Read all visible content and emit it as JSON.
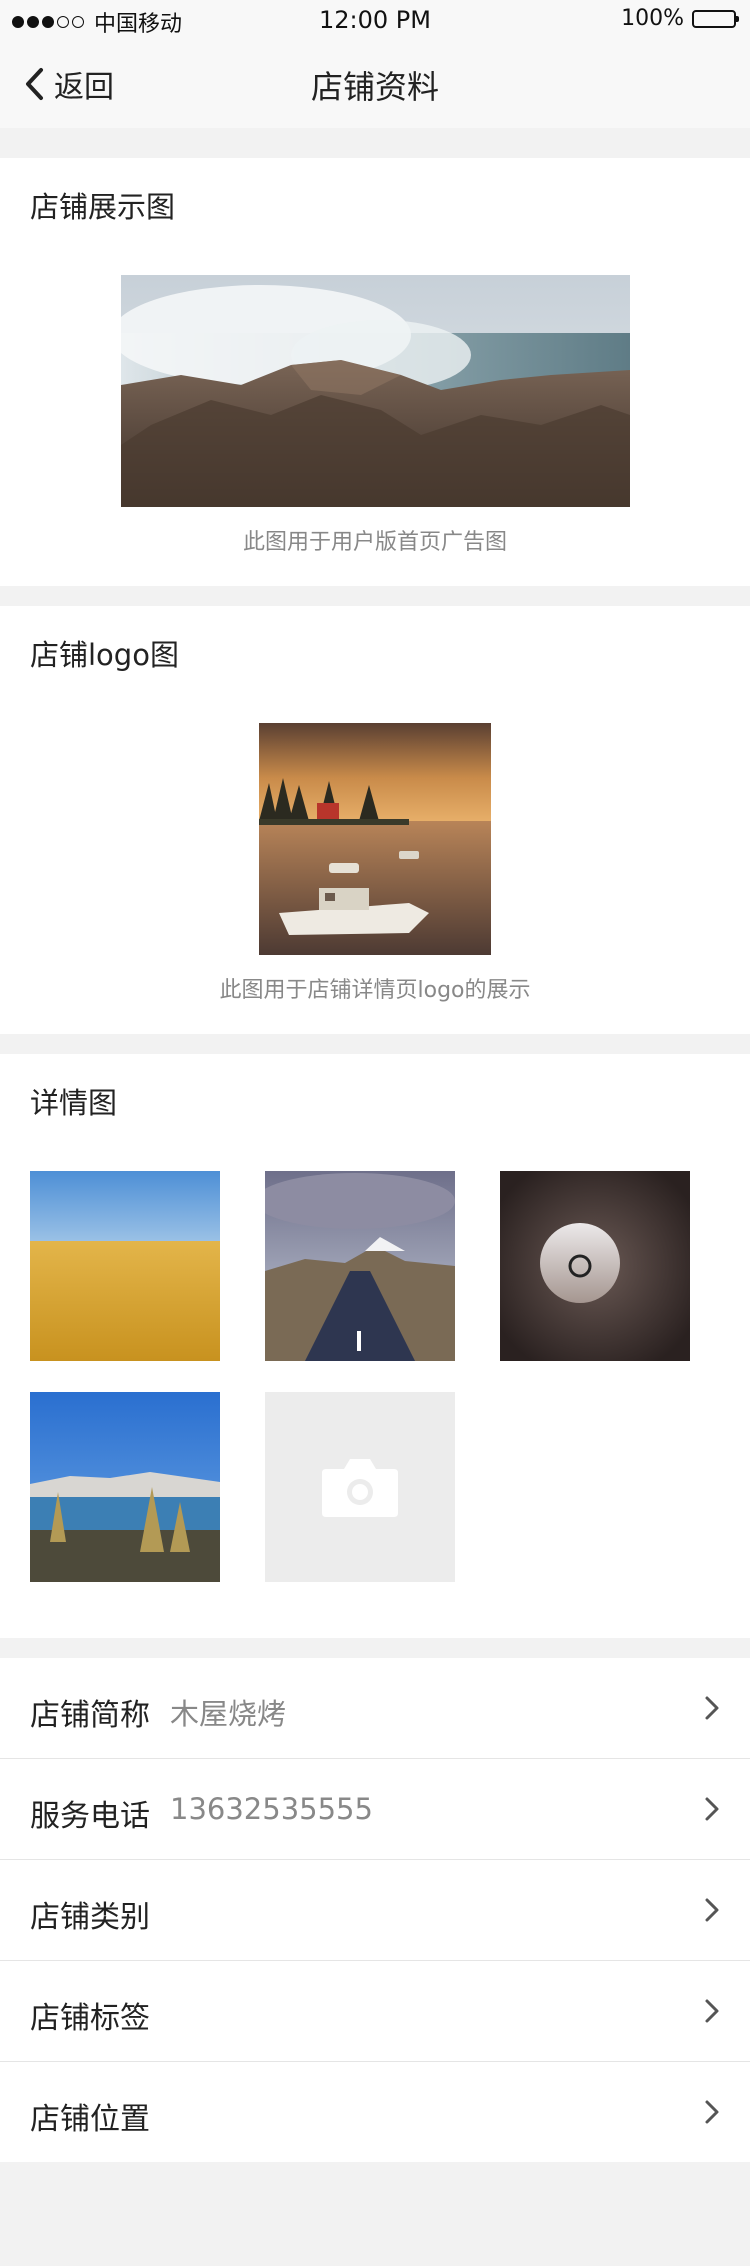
{
  "status_bar": {
    "carrier": "中国移动",
    "time": "12:00 PM",
    "battery": "100%"
  },
  "nav": {
    "back_label": "返回",
    "title": "店铺资料"
  },
  "banner_section": {
    "title": "店铺展示图",
    "caption": "此图用于用户版首页广告图"
  },
  "logo_section": {
    "title": "店铺logo图",
    "caption": "此图用于店铺详情页logo的展示"
  },
  "detail_section": {
    "title": "详情图"
  },
  "list": [
    {
      "label": "店铺简称",
      "value": "木屋烧烤"
    },
    {
      "label": "服务电话",
      "value": "13632535555"
    },
    {
      "label": "店铺类别",
      "value": ""
    },
    {
      "label": "店铺标签",
      "value": ""
    },
    {
      "label": "店铺位置",
      "value": ""
    }
  ],
  "icons": {
    "back": "chevron-left-icon",
    "row": "chevron-right-icon",
    "upload": "camera-icon"
  }
}
